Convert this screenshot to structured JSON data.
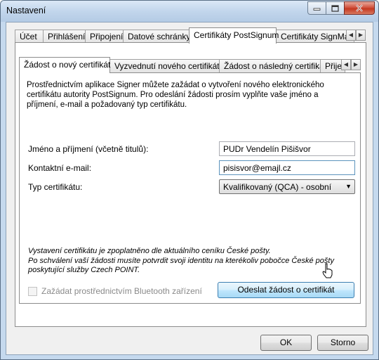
{
  "window": {
    "title": "Nastavení",
    "minimize_label": "minimize",
    "maximize_label": "maximize",
    "close_label": "close"
  },
  "outer_tabs": [
    {
      "label": "Účet"
    },
    {
      "label": "Přihlášení"
    },
    {
      "label": "Připojení"
    },
    {
      "label": "Datové schránky"
    },
    {
      "label": "Certifikáty PostSignum",
      "active": true
    },
    {
      "label": "Certifikáty SignMaster"
    }
  ],
  "inner_tabs": [
    {
      "label": "Žádost o nový certifikát",
      "active": true
    },
    {
      "label": "Vyzvednutí nového certifikátu"
    },
    {
      "label": "Žádost o následný certifikát"
    },
    {
      "label": "Přijetí"
    }
  ],
  "form": {
    "description": "Prostřednictvím aplikace Signer můžete zažádat o vytvoření nového elektronického certifikátu autority PostSignum. Pro odeslání žádosti prosím vyplňte vaše jméno a příjmení, e-mail a požadovaný typ certifikátu.",
    "name_label": "Jméno a příjmení (včetně titulů):",
    "name_value": "PUDr Vendelín Pišišvor",
    "email_label": "Kontaktní e-mail:",
    "email_value": "pisisvor@emajl.cz",
    "type_label": "Typ certifikátu:",
    "type_value": "Kvalifikovaný (QCA) - osobní",
    "note_line1": "Vystavení certifikátu je zpoplatněno dle aktuálního ceníku České pošty.",
    "note_line2": "Po schválení vaší žádosti musíte potvrdit svoji identitu na kterékoliv pobočce České pošty poskytující služby Czech POINT.",
    "bluetooth_label": "Zažádat prostřednictvím Bluetooth zařízení",
    "submit_label": "Odeslat žádost o certifikát"
  },
  "dialog_buttons": {
    "ok_label": "OK",
    "cancel_label": "Storno"
  },
  "colors": {
    "window_frame": "#c5d9ee",
    "close_button": "#c43820",
    "primary_button_border": "#3c7fb1"
  }
}
